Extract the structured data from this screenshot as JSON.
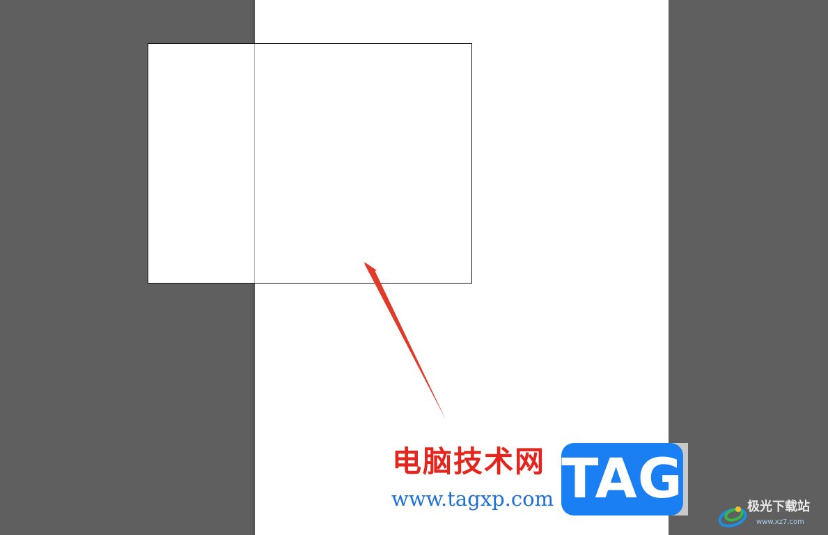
{
  "canvas": {
    "pasteboard_color": "#5f5f5f",
    "artboard_color": "#ffffff",
    "arrow_color": "#e03a2a"
  },
  "watermark": {
    "site_name": "电脑技术网",
    "site_url": "www.tagxp.com",
    "badge_text": "TAG",
    "badge_color": "#1a7ff2",
    "corner_site_name": "极光下载站",
    "corner_site_url": "www.xz7.com"
  }
}
